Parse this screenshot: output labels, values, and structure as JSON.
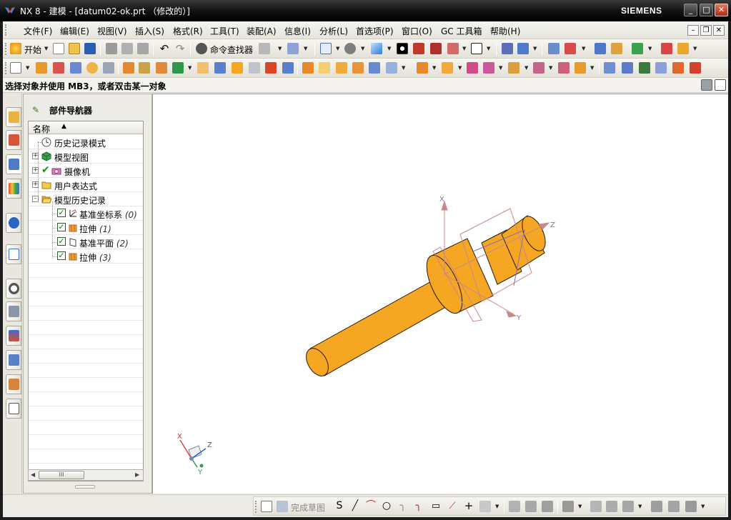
{
  "window": {
    "title": "NX 8 - 建模 - [datum02-ok.prt （修改的）]",
    "brand": "SIEMENS",
    "controls": {
      "minimize": "_",
      "maximize": "□",
      "close": "✕"
    }
  },
  "menubar": {
    "items": [
      {
        "label": "文件(F)",
        "underline": "F"
      },
      {
        "label": "编辑(E)",
        "underline": "E"
      },
      {
        "label": "视图(V)",
        "underline": "V"
      },
      {
        "label": "插入(S)",
        "underline": "S"
      },
      {
        "label": "格式(R)",
        "underline": "R"
      },
      {
        "label": "工具(T)",
        "underline": "T"
      },
      {
        "label": "装配(A)",
        "underline": "A"
      },
      {
        "label": "信息(I)",
        "underline": "I"
      },
      {
        "label": "分析(L)",
        "underline": "L"
      },
      {
        "label": "首选项(P)",
        "underline": "P"
      },
      {
        "label": "窗口(O)",
        "underline": "O"
      },
      {
        "label": "GC 工具箱",
        "underline": ""
      },
      {
        "label": "帮助(H)",
        "underline": "H"
      }
    ],
    "mdi": {
      "minimize": "–",
      "restore": "❐",
      "close": "✕"
    }
  },
  "toolbar1": {
    "start_label": "开始",
    "command_finder_label": "命令查找器"
  },
  "cue_line": {
    "prompt": "选择对象并使用 MB3，或者双击某一对象"
  },
  "navigator": {
    "title": "部件导航器",
    "column_name": "名称",
    "sort_indicator": "▲",
    "rows": [
      {
        "label": "历史记录模式",
        "index": "",
        "icon": "clock-icon",
        "level": 0,
        "expander": "",
        "checked": false
      },
      {
        "label": "模型视图",
        "index": "",
        "icon": "model-views-icon",
        "level": 0,
        "expander": "+",
        "checked": false
      },
      {
        "label": "摄像机",
        "index": "",
        "icon": "camera-icon",
        "level": 0,
        "expander": "+",
        "checked": true
      },
      {
        "label": "用户表达式",
        "index": "",
        "icon": "folder-icon",
        "level": 0,
        "expander": "+",
        "checked": false
      },
      {
        "label": "模型历史记录",
        "index": "",
        "icon": "open-folder-icon",
        "level": 0,
        "expander": "–",
        "checked": false
      },
      {
        "label": "基准坐标系",
        "index": "(0)",
        "icon": "datum-csys-icon",
        "level": 1,
        "expander": "",
        "checked": true
      },
      {
        "label": "拉伸",
        "index": "(1)",
        "icon": "extrude-icon",
        "level": 1,
        "expander": "",
        "checked": true
      },
      {
        "label": "基准平面",
        "index": "(2)",
        "icon": "datum-plane-icon",
        "level": 1,
        "expander": "",
        "checked": true
      },
      {
        "label": "拉伸",
        "index": "(3)",
        "icon": "extrude-icon",
        "level": 1,
        "expander": "",
        "checked": true
      }
    ],
    "scroll_thumb_glyph": "III",
    "scroll_left": "◀",
    "scroll_right": "▶"
  },
  "viewport": {
    "axis_labels": {
      "x": "X",
      "y": "Y",
      "z": "Z"
    },
    "model_color": "#F5A623",
    "datum_color": "#C9888A"
  },
  "sketch_toolbar": {
    "finish_sketch_label": "完成草图"
  },
  "colors": {
    "accent_orange": "#F5A623",
    "title_bar": "#000000",
    "check_green": "#0A7A0A"
  }
}
